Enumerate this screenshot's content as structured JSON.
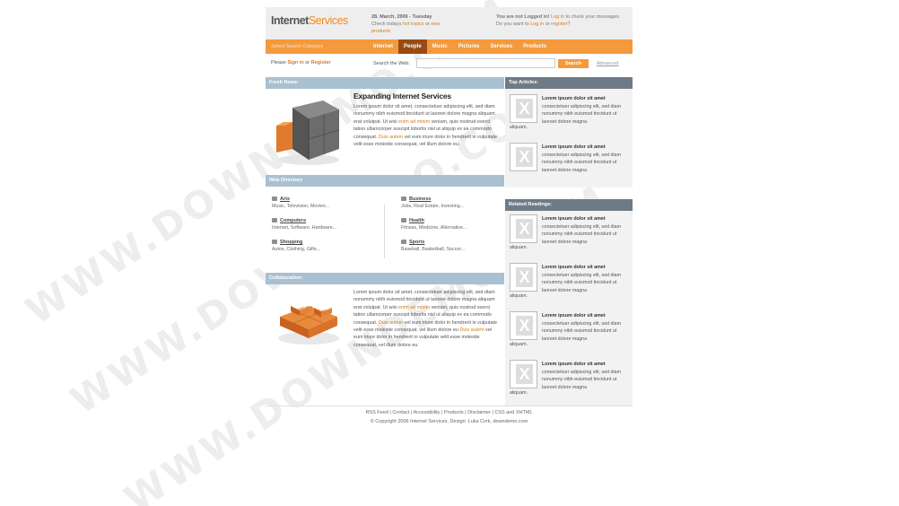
{
  "header": {
    "logo_part1": "Internet",
    "logo_part2": "Services",
    "date_line": "28. March, 2006 - Tuesday",
    "date_sub_prefix": "Check todays",
    "date_link_hot": "hot topics",
    "date_or": "or",
    "date_link_new": "new",
    "date_link_products": "products",
    "login_line1_prefix": "You are not Logged in!",
    "login_link": "Log in",
    "login_line1_suffix": "to check your messages.",
    "login_line2_prefix": "Do you want to",
    "login_link2": "Log in",
    "login_or": "or",
    "register_link": "register",
    "login_q": "?"
  },
  "nav": {
    "category_placeholder": "Select Search Category",
    "items": [
      "Internet",
      "People",
      "Music",
      "Pictures",
      "Services",
      "Products"
    ],
    "active_index": 1
  },
  "subbar": {
    "please": "Please",
    "sign_in": "Sign in",
    "or": "or",
    "register": "Register",
    "search_label": "Search the Web:",
    "search_button": "Search",
    "advanced": "Advanced"
  },
  "fresh_news": {
    "heading": "Fresh News:",
    "title": "Expanding Internet Services",
    "text_a": "Lorem ipsum dolor sit amet, consectetuer adipiscing elit, sed diam nonummy nibh euismod tincidunt ut laoreet dolore magna aliquam erat volutpat. Ut wisi",
    "link_a": "enim ad minim",
    "text_b": "veniam, quis nostrud exerci tation ullamcorper suscipit lobortis nisl ut aliquip ex ea commodo consequat.",
    "link_b": "Duis autem",
    "text_c": "vel eum iriure dolor in hendrerit in vulputate velit esse molestie consequat, vel illum dolore eu."
  },
  "directory": {
    "heading": "Web Directory",
    "items": [
      {
        "title": "Arts",
        "sub": "Music, Television, Movies..."
      },
      {
        "title": "Business",
        "sub": "Jobs, Real Estate, Investing..."
      },
      {
        "title": "Computers",
        "sub": "Internet, Software, Hardware..."
      },
      {
        "title": "Health",
        "sub": "Fitness, Medicine, Alternative..."
      },
      {
        "title": "Shopping",
        "sub": "Autos, Clothing, Gifts..."
      },
      {
        "title": "Sports",
        "sub": "Baseball, Basketball, Soccer..."
      }
    ]
  },
  "collaboration": {
    "heading": "Collaboration:",
    "text_a": "Lorem ipsum dolor sit amet, consectetuer adipiscing elit, sed diam nonummy nibh euismod tincidunt ut laoreet dolore magna aliquam erat volutpat. Ut wisi",
    "link_a": "enim ad minim",
    "text_b": "veniam, quis nostrud exerci tation ullamcorper suscipit lobortis nisl ut aliquip ex ea commodo consequat.",
    "link_b": "Duis autem",
    "text_c": "vel eum iriure dolor in hendrerit in vulputate velit esse molestie consequat, vel illum dolore eu",
    "link_c": "Duis autem",
    "text_d": "vel eum iriure dolor in hendrerit in vulputate velit esse molestie consequat, vel illum dolore eu"
  },
  "top_articles": {
    "heading": "Top Articles:",
    "items": [
      {
        "title": "Lorem ipsum dolor sit amet",
        "desc": "consectetuer adipiscing elit, sed diam nonummy nibh euismod tincidunt ut laoreet dolore magna",
        "tail": "aliquam."
      },
      {
        "title": "Lorem ipsum dolor sit amet",
        "desc": "consectetuer adipiscing elit, sed diam nonummy nibh euismod tincidunt ut laoreet dolore magna",
        "tail": ""
      }
    ]
  },
  "related": {
    "heading": "Related Readings:",
    "items": [
      {
        "title": "Lorem ipsum dolor sit amet",
        "desc": "consectetuer adipiscing elit, sed diam nonummy nibh euismod tincidunt ut laoreet dolore magna",
        "tail": "aliquam."
      },
      {
        "title": "Lorem ipsum dolor sit amet",
        "desc": "consectetuer adipiscing elit, sed diam nonummy nibh euismod tincidunt ut laoreet dolore magna",
        "tail": "aliquam."
      },
      {
        "title": "Lorem ipsum dolor sit amet",
        "desc": "consectetuer adipiscing elit, sed diam nonummy nibh euismod tincidunt ut laoreet dolore magna",
        "tail": "aliquam."
      },
      {
        "title": "Lorem ipsum dolor sit amet",
        "desc": "consectetuer adipiscing elit, sed diam nonummy nibh euismod tincidunt ut laoreet dolore magna",
        "tail": "aliquam."
      }
    ]
  },
  "footer": {
    "links": [
      "RSS Feed",
      "Contact",
      "Accessibility",
      "Products",
      "Disclaimer",
      "CSS"
    ],
    "and": "and",
    "xhtml": "XHTML",
    "copyright": "© Copyright 2006 Internet Services, Design: Luka Cvrk,",
    "credit_link": "downdemo.com"
  },
  "watermark": "WWW.DOWNDEMO.COM",
  "colors": {
    "accent_orange": "#f49a3c",
    "nav_active": "#9a4b15",
    "bar_blue": "#a9c0d0",
    "bar_gray": "#6e7b86"
  }
}
